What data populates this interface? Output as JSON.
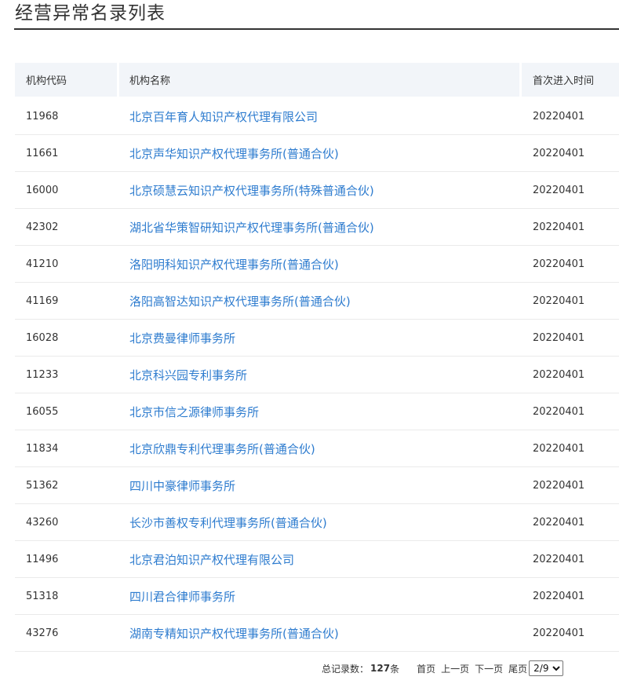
{
  "page": {
    "title": "经营异常名录列表"
  },
  "table": {
    "headers": {
      "code": "机构代码",
      "name": "机构名称",
      "date": "首次进入时间"
    },
    "rows": [
      {
        "code": "11968",
        "name": "北京百年育人知识产权代理有限公司",
        "date": "20220401"
      },
      {
        "code": "11661",
        "name": "北京声华知识产权代理事务所(普通合伙)",
        "date": "20220401"
      },
      {
        "code": "16000",
        "name": "北京硕慧云知识产权代理事务所(特殊普通合伙)",
        "date": "20220401"
      },
      {
        "code": "42302",
        "name": "湖北省华策智研知识产权代理事务所(普通合伙)",
        "date": "20220401"
      },
      {
        "code": "41210",
        "name": "洛阳明科知识产权代理事务所(普通合伙)",
        "date": "20220401"
      },
      {
        "code": "41169",
        "name": "洛阳高智达知识产权代理事务所(普通合伙)",
        "date": "20220401"
      },
      {
        "code": "16028",
        "name": "北京费曼律师事务所",
        "date": "20220401"
      },
      {
        "code": "11233",
        "name": "北京科兴园专利事务所",
        "date": "20220401"
      },
      {
        "code": "16055",
        "name": "北京市信之源律师事务所",
        "date": "20220401"
      },
      {
        "code": "11834",
        "name": "北京欣鼎专利代理事务所(普通合伙)",
        "date": "20220401"
      },
      {
        "code": "51362",
        "name": "四川中豪律师事务所",
        "date": "20220401"
      },
      {
        "code": "43260",
        "name": "长沙市善权专利代理事务所(普通合伙)",
        "date": "20220401"
      },
      {
        "code": "11496",
        "name": "北京君泊知识产权代理有限公司",
        "date": "20220401"
      },
      {
        "code": "51318",
        "name": "四川君合律师事务所",
        "date": "20220401"
      },
      {
        "code": "43276",
        "name": "湖南专精知识产权代理事务所(普通合伙)",
        "date": "20220401"
      }
    ]
  },
  "pager": {
    "total_label": "总记录数：",
    "total_count": "127",
    "total_unit": "条",
    "first": "首页",
    "prev": "上一页",
    "next": "下一页",
    "last": "尾页",
    "page_select": "2/9"
  }
}
